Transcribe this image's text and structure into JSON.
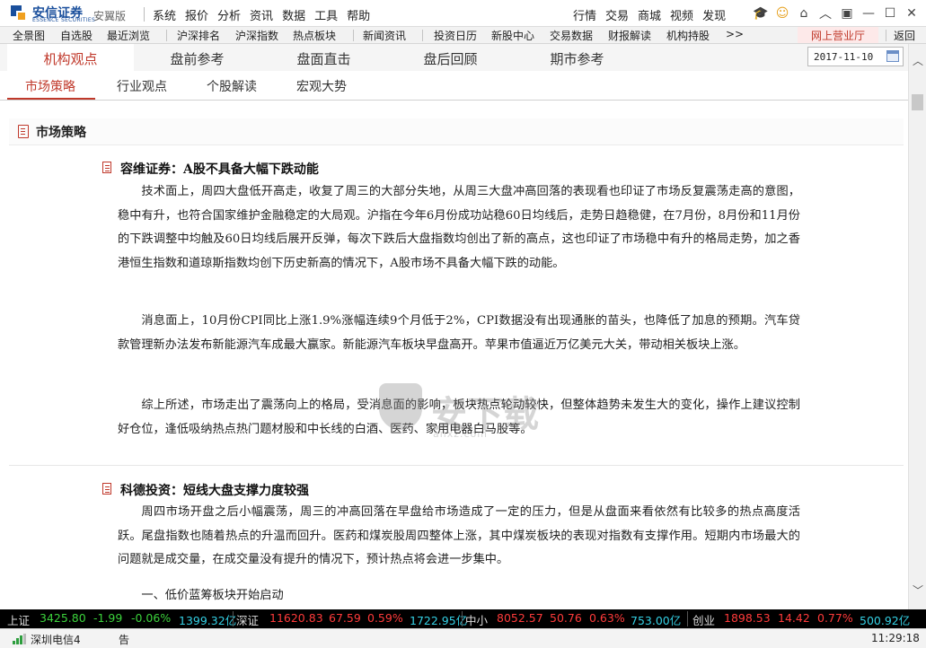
{
  "app": {
    "brand": "安信证券",
    "brand_en": "ESSENCE SECURITIES",
    "edition": "安翼版",
    "menu": [
      "系统",
      "报价",
      "分析",
      "资讯",
      "数据",
      "工具",
      "帮助"
    ],
    "right_menu": [
      "行情",
      "交易",
      "商城",
      "视频",
      "发现"
    ]
  },
  "toolbar": {
    "items": [
      "全景图",
      "自选股",
      "最近浏览",
      "沪深排名",
      "沪深指数",
      "热点板块",
      "新闻资讯",
      "投资日历",
      "新股中心",
      "交易数据",
      "财报解读",
      "机构持股",
      ">>"
    ],
    "online_hall": "网上营业厅",
    "back": "返回"
  },
  "tabs_primary": [
    "机构观点",
    "盘前参考",
    "盘面直击",
    "盘后回顾",
    "期市参考"
  ],
  "date": "2017-11-10",
  "tabs_secondary": [
    "市场策略",
    "行业观点",
    "个股解读",
    "宏观大势"
  ],
  "section": {
    "title": "市场策略"
  },
  "articles": [
    {
      "title": "容维证券：A股不具备大幅下跌动能",
      "paragraphs": [
        "技术面上，周四大盘低开高走，收复了周三的大部分失地，从周三大盘冲高回落的表现看也印证了市场反复震荡走高的意图，稳中有升，也符合国家维护金融稳定的大局观。沪指在今年6月份成功站稳60日均线后，走势日趋稳健，在7月份，8月份和11月份的下跌调整中均触及60日均线后展开反弹，每次下跌后大盘指数均创出了新的高点，这也印证了市场稳中有升的格局走势，加之香港恒生指数和道琼斯指数均创下历史新高的情况下，A股市场不具备大幅下跌的动能。",
        "消息面上，10月份CPI同比上涨1.9%涨幅连续9个月低于2%，CPI数据没有出现通胀的苗头，也降低了加息的预期。汽车贷款管理新办法发布新能源汽车成最大赢家。新能源汽车板块早盘高开。苹果市值逼近万亿美元大关，带动相关板块上涨。",
        "综上所述，市场走出了震荡向上的格局，受消息面的影响，板块热点轮动较快，但整体趋势未发生大的变化，操作上建议控制好仓位，逢低吸纳热点热门题材股和中长线的白酒、医药、家用电器白马股等。"
      ]
    },
    {
      "title": "科德投资：短线大盘支撑力度较强",
      "paragraphs": [
        "周四市场开盘之后小幅震荡，周三的冲高回落在早盘给市场造成了一定的压力，但是从盘面来看依然有比较多的热点高度活跃。尾盘指数也随着热点的升温而回升。医药和煤炭股周四整体上涨，其中煤炭板块的表现对指数有支撑作用。短期内市场最大的问题就是成交量，在成交量没有提升的情况下，预计热点将会进一步集中。",
        "一、低价蓝筹板块开始启动"
      ]
    }
  ],
  "watermark": {
    "text": "安下载",
    "url": "anxz.com"
  },
  "ticker": [
    {
      "name": "上证",
      "price": "3425.80",
      "change": "-1.99",
      "pct": "-0.06%",
      "volume": "1399.32亿",
      "trend": "down"
    },
    {
      "name": "深证",
      "price": "11620.83",
      "change": "67.59",
      "pct": "0.59%",
      "volume": "1722.95亿",
      "trend": "up"
    },
    {
      "name": "中小",
      "price": "8052.57",
      "change": "50.76",
      "pct": "0.63%",
      "volume": "753.00亿",
      "trend": "up"
    },
    {
      "name": "创业",
      "price": "1898.53",
      "change": "14.42",
      "pct": "0.77%",
      "volume": "500.92亿",
      "trend": "up"
    }
  ],
  "status": {
    "server": "深圳电信4",
    "message": "告",
    "time": "11:29:18"
  },
  "colors": {
    "accent": "#c0392b",
    "brand": "#1a4f9c",
    "up": "#ff3b3b",
    "down": "#3cd33c",
    "volume": "#34d0e4"
  }
}
